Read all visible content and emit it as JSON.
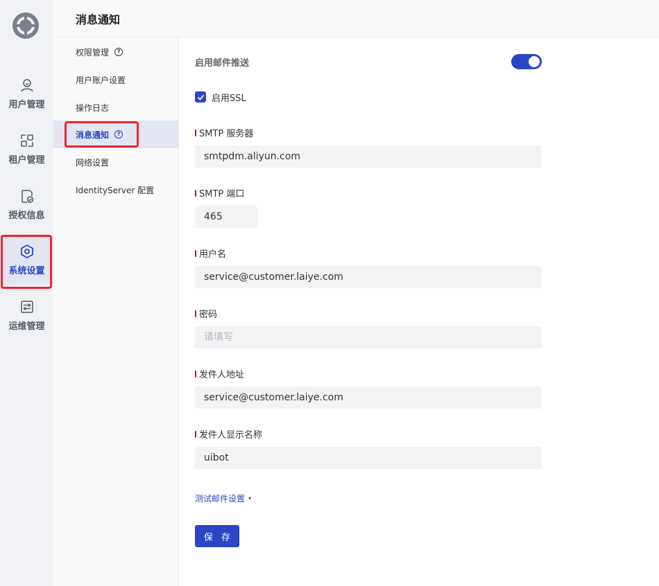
{
  "rail": {
    "items": [
      {
        "label": "用户管理",
        "icon": "user-icon"
      },
      {
        "label": "租户管理",
        "icon": "tenant-icon"
      },
      {
        "label": "授权信息",
        "icon": "license-icon"
      },
      {
        "label": "系统设置",
        "icon": "settings-icon"
      },
      {
        "label": "运维管理",
        "icon": "ops-icon"
      }
    ],
    "active_index": 3
  },
  "header": {
    "title": "消息通知"
  },
  "subnav": {
    "items": [
      {
        "label": "权限管理"
      },
      {
        "label": "用户账户设置"
      },
      {
        "label": "操作日志"
      },
      {
        "label": "消息通知"
      },
      {
        "label": "网络设置"
      },
      {
        "label": "IdentityServer 配置"
      }
    ],
    "active_index": 3
  },
  "form": {
    "enable_email_label": "启用邮件推送",
    "enable_email_on": true,
    "ssl_label": "启用SSL",
    "ssl_checked": true,
    "smtp_server_label": "SMTP 服务器",
    "smtp_server_value": "smtpdm.aliyun.com",
    "smtp_port_label": "SMTP 端口",
    "smtp_port_value": "465",
    "username_label": "用户名",
    "username_value": "service@customer.laiye.com",
    "password_label": "密码",
    "password_placeholder": "请填写",
    "sender_address_label": "发件人地址",
    "sender_address_value": "service@customer.laiye.com",
    "sender_name_label": "发件人显示名称",
    "sender_name_value": "uibot",
    "test_link_label": "测试邮件设置",
    "save_label": "保 存"
  },
  "colors": {
    "accent": "#2a46c4",
    "highlight": "#f5222d",
    "required_mark": "#d0021b"
  }
}
